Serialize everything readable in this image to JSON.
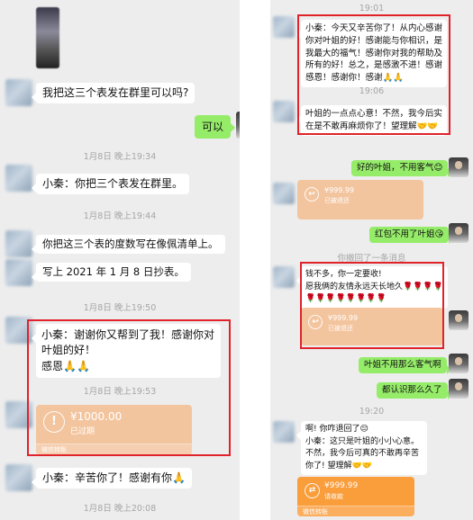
{
  "left": {
    "messages": [
      "我把这三个表发在群里可以吗?",
      "可以",
      "小秦：你把三个表发在群里。",
      "你把这三个表的度数写在像佩清单上。",
      "写上 2021 年 1 月 8 日抄表。",
      "小秦：谢谢你又帮到了我！感谢你对叶姐的好！\n感恩🙏🙏",
      "小秦：辛苦你了！感谢有你🙏"
    ],
    "timestamps": [
      "1月8日 晚上19:34",
      "1月8日 晚上19:44",
      "1月8日 晚上19:50",
      "1月8日 晚上19:53",
      "1月8日 晚上20:08"
    ],
    "transfer": {
      "amount": "¥1000.00",
      "status": "已过期",
      "footer": "微信转账"
    }
  },
  "right": {
    "timestamps": [
      "19:01",
      "19:06",
      "19:20"
    ],
    "messages": {
      "thanks": "小秦：今天又辛苦你了！从内心感谢你对叶姐的好！感谢能与你相识，是我最大的福气！感谢你对我的帮助及所有的好！总之，是感激不进！感谢感恩！感谢你！感谢🙏🙏",
      "gift": "叶姐的一点点心意！不然，我今后实在是不敢再麻烦你了！望理解🤝🤝",
      "reply1": "好的叶姐，不用客气😊",
      "reply2": "红包不用了叶姐😘",
      "system": "你撤回了一条消息",
      "money": "钱不多，你一定要收!\n愿我俩的友情永远天长地久🌹🌹🌹🌹\n🌹🌹🌹🌹🌹🌹🌹🌹",
      "reply3": "叶姐不用那么客气啊",
      "reply4": "都认识那么久了",
      "return": "啊! 你咋退回了😔\n小秦：这只是叶姐的小小心意。不然，我今后可真的不敢再辛苦你了! 望理解🤝🤝"
    },
    "transfers": [
      {
        "amount": "¥999.99",
        "status": "已被退还"
      },
      {
        "amount": "¥999.99",
        "status": "已被退还"
      },
      {
        "amount": "¥999.99",
        "status": "请收款",
        "footer": "微信转账"
      }
    ]
  },
  "colors": {
    "green_bubble": "#95ec69",
    "red_box": "#e0222b",
    "transfer_orange": "#fa9d3b"
  }
}
